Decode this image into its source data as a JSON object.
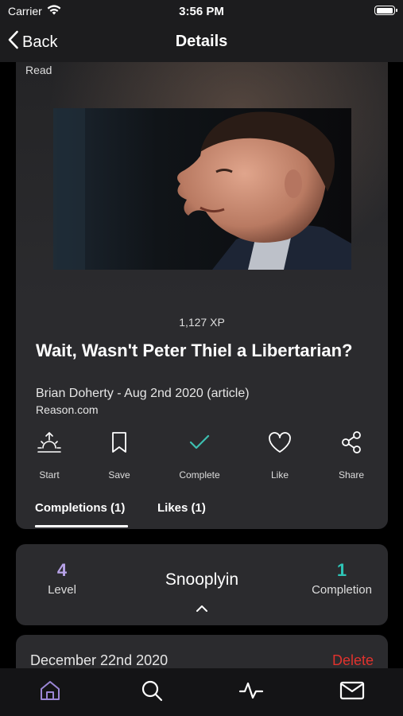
{
  "status_bar": {
    "carrier": "Carrier",
    "time": "3:56 PM",
    "battery_level": 1.0
  },
  "nav": {
    "back_label": "Back",
    "title": "Details"
  },
  "article": {
    "read_label": "Read",
    "xp": "1,127 XP",
    "title": "Wait, Wasn't Peter Thiel a Libertarian?",
    "byline": "Brian Doherty - Aug 2nd 2020 (article)",
    "source": "Reason.com"
  },
  "actions": [
    {
      "label": "Start",
      "icon": "sunrise-icon"
    },
    {
      "label": "Save",
      "icon": "bookmark-icon"
    },
    {
      "label": "Complete",
      "icon": "checkmark-icon"
    },
    {
      "label": "Like",
      "icon": "heart-icon"
    },
    {
      "label": "Share",
      "icon": "share-icon"
    }
  ],
  "tabs": [
    {
      "label": "Completions (1)",
      "active": true
    },
    {
      "label": "Likes (1)",
      "active": false
    }
  ],
  "profile": {
    "level_value": "4",
    "level_label": "Level",
    "username": "Snooplyin",
    "completion_value": "1",
    "completion_label": "Completion"
  },
  "completion_entry": {
    "date": "December 22nd 2020",
    "delete_label": "Delete"
  },
  "tab_bar": [
    {
      "icon": "home-icon",
      "active": true
    },
    {
      "icon": "search-icon",
      "active": false
    },
    {
      "icon": "activity-icon",
      "active": false
    },
    {
      "icon": "mail-icon",
      "active": false
    }
  ],
  "colors": {
    "background": "#000000",
    "card": "#2b2b2e",
    "level_accent": "#b8a3e8",
    "completion_accent": "#2ec4b6",
    "complete_check": "#3dbfb0",
    "delete": "#e0322d",
    "home_active": "#9b86d6"
  }
}
